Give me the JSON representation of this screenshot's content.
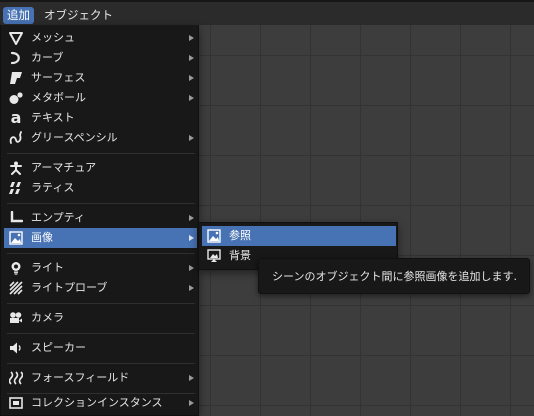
{
  "topbar": {
    "tabs": [
      {
        "label": "追加",
        "active": true
      },
      {
        "label": "オブジェクト",
        "active": false
      }
    ]
  },
  "add_menu": {
    "items": [
      {
        "label": "メッシュ",
        "icon": "mesh-icon",
        "has_submenu": true
      },
      {
        "label": "カーブ",
        "icon": "curve-icon",
        "has_submenu": true
      },
      {
        "label": "サーフェス",
        "icon": "surface-icon",
        "has_submenu": true
      },
      {
        "label": "メタボール",
        "icon": "metaball-icon",
        "has_submenu": true
      },
      {
        "label": "テキスト",
        "icon": "text-icon",
        "has_submenu": false
      },
      {
        "label": "グリースペンシル",
        "icon": "grease-pencil-icon",
        "has_submenu": true
      },
      {
        "label": "アーマチュア",
        "icon": "armature-icon",
        "has_submenu": false
      },
      {
        "label": "ラティス",
        "icon": "lattice-icon",
        "has_submenu": false
      },
      {
        "label": "エンプティ",
        "icon": "empty-icon",
        "has_submenu": true
      },
      {
        "label": "画像",
        "icon": "image-icon",
        "has_submenu": true,
        "highlighted": true
      },
      {
        "label": "ライト",
        "icon": "light-icon",
        "has_submenu": true
      },
      {
        "label": "ライトプローブ",
        "icon": "light-probe-icon",
        "has_submenu": true
      },
      {
        "label": "カメラ",
        "icon": "camera-icon",
        "has_submenu": false
      },
      {
        "label": "スピーカー",
        "icon": "speaker-icon",
        "has_submenu": false
      },
      {
        "label": "フォースフィールド",
        "icon": "force-field-icon",
        "has_submenu": true
      },
      {
        "label": "コレクションインスタンス",
        "icon": "collection-instance-icon",
        "has_submenu": true
      }
    ]
  },
  "image_submenu": {
    "items": [
      {
        "label": "参照",
        "icon": "image-reference-icon",
        "highlighted": true
      },
      {
        "label": "背景",
        "icon": "image-background-icon",
        "highlighted": false
      }
    ]
  },
  "tooltip": {
    "text": "シーンのオブジェクト間に参照画像を追加します."
  },
  "colors": {
    "accent": "#4772b3",
    "menu_bg": "#181818",
    "viewport_bg": "#3d3d3d"
  }
}
